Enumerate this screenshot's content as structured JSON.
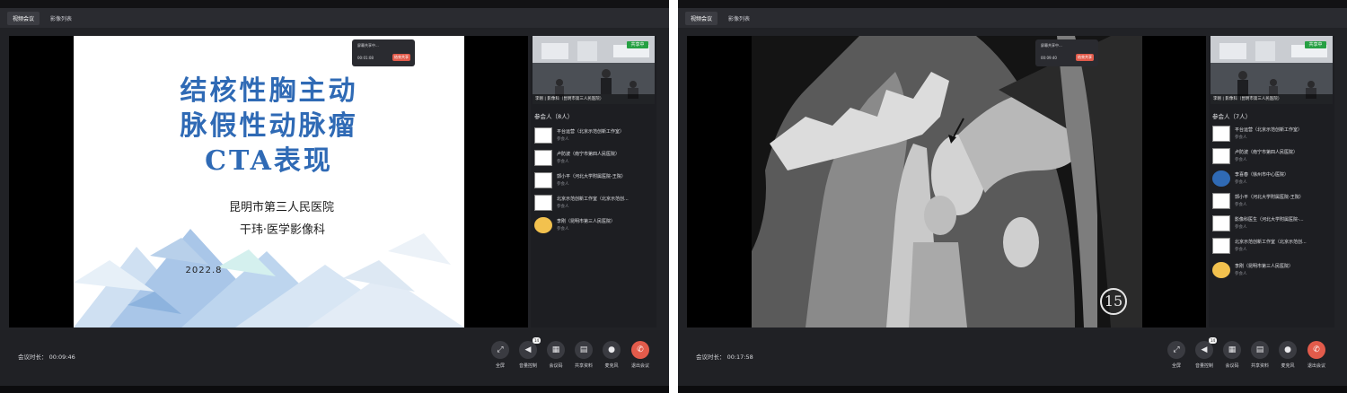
{
  "left": {
    "tabs": [
      "视频会议",
      "影像列表"
    ],
    "slide": {
      "title_lines": [
        "结核性胸主动",
        "脉假性动脉瘤",
        "CTA表现"
      ],
      "hospital": "昆明市第三人民医院",
      "author": "干玮·医学影像科",
      "date": "2022.8"
    },
    "popup": {
      "title": "屏幕共享中...",
      "time": "00:01:08",
      "button": "结束共享"
    },
    "video_tile": {
      "badge": "共享中",
      "name": "李刚 | 影像科（昆明市第三人民医院）"
    },
    "participants_title": "参会人（8人）",
    "participants": [
      {
        "name": "平台运营（北京示范创新工作室）",
        "role": "参会人",
        "avatar": "blank"
      },
      {
        "name": "卢防波（南宁市第四人民医院）",
        "role": "参会人",
        "avatar": "blank"
      },
      {
        "name": "郭小平（河北大学附属医院-王院）",
        "role": "参会人",
        "avatar": "blank"
      },
      {
        "name": "北京示范创新工作室（北京示范创...",
        "role": "参会人",
        "avatar": "blank"
      },
      {
        "name": "李刚（昆明市第三人民医院）",
        "role": "参会人",
        "avatar": "bear"
      }
    ],
    "duration_label": "会议时长：",
    "duration": "00:09:46"
  },
  "right": {
    "tabs": [
      "视频会议",
      "影像列表"
    ],
    "ct_label": "15",
    "popup": {
      "title": "屏幕共享中...",
      "time": "00:09:40",
      "button": "结束共享"
    },
    "video_tile": {
      "badge": "共享中",
      "name": "李刚 | 影像科（昆明市第三人民医院）"
    },
    "participants_title": "参会人（7人）",
    "participants": [
      {
        "name": "平台运营（北京示范创新工作室）",
        "role": "参会人",
        "avatar": "blank"
      },
      {
        "name": "卢防波（南宁市第四人民医院）",
        "role": "参会人",
        "avatar": "blank"
      },
      {
        "name": "李喜春（徐州市中心医院）",
        "role": "参会人",
        "avatar": "doc"
      },
      {
        "name": "郭小平（河北大学附属医院-王院）",
        "role": "参会人",
        "avatar": "blank"
      },
      {
        "name": "影像科医生（河北大学附属医院-...",
        "role": "参会人",
        "avatar": "blank"
      },
      {
        "name": "北京示范创新工作室（北京示范创...",
        "role": "参会人",
        "avatar": "blank"
      },
      {
        "name": "李刚（昆明市第三人民医院）",
        "role": "参会人",
        "avatar": "bear"
      }
    ],
    "duration_label": "会议时长：",
    "duration": "00:17:58"
  },
  "controls": [
    {
      "label": "全屏",
      "icon": "fullscreen-icon",
      "glyph": "⤢"
    },
    {
      "label": "音量控制",
      "icon": "speaker-icon",
      "glyph": "◀",
      "badge": "14"
    },
    {
      "label": "会议码",
      "icon": "qrcode-icon",
      "glyph": "▦"
    },
    {
      "label": "共享资料",
      "icon": "document-icon",
      "glyph": "▤"
    },
    {
      "label": "麦克风",
      "icon": "microphone-icon",
      "glyph": "●"
    },
    {
      "label": "退出会议",
      "icon": "hangup-icon",
      "glyph": "✆"
    }
  ]
}
